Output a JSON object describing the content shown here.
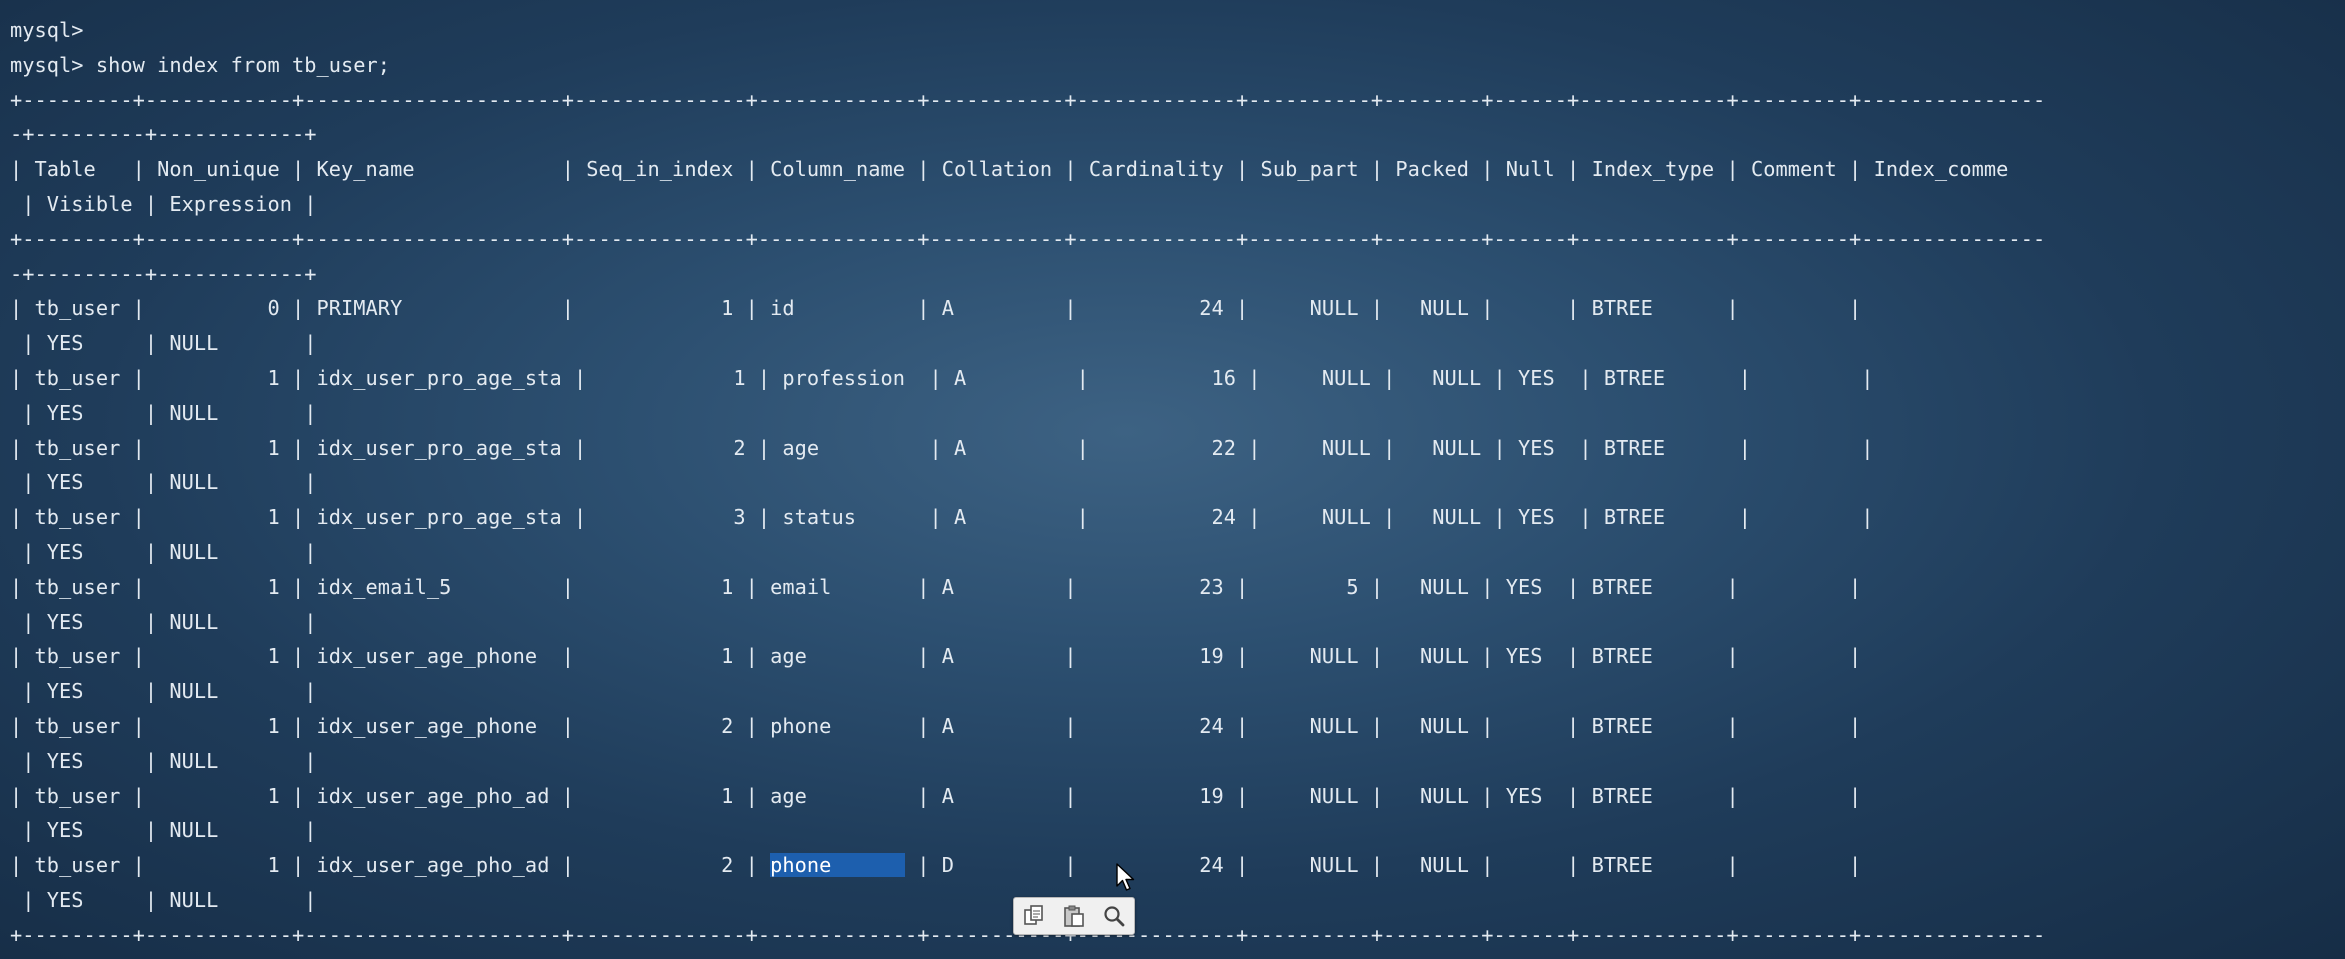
{
  "terminal": {
    "prompt_line": "mysql>",
    "command_line": "mysql> show index from tb_user;",
    "border_top_a": "+---------+------------+---------------------+--------------+-------------+-----------+-------------+----------+--------+------+------------+---------+---------------",
    "border_top_b": "-+---------+------------+",
    "header_a": "| Table   | Non_unique | Key_name            | Seq_in_index | Column_name | Collation | Cardinality | Sub_part | Packed | Null | Index_type | Comment | Index_comme",
    "header_b": " | Visible | Expression |",
    "border_mid_a": "+---------+------------+---------------------+--------------+-------------+-----------+-------------+----------+--------+------+------------+---------+---------------",
    "border_mid_b": "-+---------+------------+",
    "columns": [
      "Table",
      "Non_unique",
      "Key_name",
      "Seq_in_index",
      "Column_name",
      "Collation",
      "Cardinality",
      "Sub_part",
      "Packed",
      "Null",
      "Index_type",
      "Comment",
      "Index_comment",
      "Visible",
      "Expression"
    ],
    "rows": [
      {
        "a": "| tb_user |          0 | PRIMARY             |            1 | id          | A         |          24 |     NULL |   NULL |      | BTREE      |         |",
        "b": " | YES     | NULL       |"
      },
      {
        "a": "| tb_user |          1 | idx_user_pro_age_sta |            1 | profession  | A         |          16 |     NULL |   NULL | YES  | BTREE      |         |",
        "b": " | YES     | NULL       |"
      },
      {
        "a": "| tb_user |          1 | idx_user_pro_age_sta |            2 | age         | A         |          22 |     NULL |   NULL | YES  | BTREE      |         |",
        "b": " | YES     | NULL       |"
      },
      {
        "a": "| tb_user |          1 | idx_user_pro_age_sta |            3 | status      | A         |          24 |     NULL |   NULL | YES  | BTREE      |         |",
        "b": " | YES     | NULL       |"
      },
      {
        "a": "| tb_user |          1 | idx_email_5         |            1 | email       | A         |          23 |        5 |   NULL | YES  | BTREE      |         |",
        "b": " | YES     | NULL       |"
      },
      {
        "a": "| tb_user |          1 | idx_user_age_phone  |            1 | age         | A         |          19 |     NULL |   NULL | YES  | BTREE      |         |",
        "b": " | YES     | NULL       |"
      },
      {
        "a": "| tb_user |          1 | idx_user_age_phone  |            2 | phone       | A         |          24 |     NULL |   NULL |      | BTREE      |         |",
        "b": " | YES     | NULL       |"
      },
      {
        "a": "| tb_user |          1 | idx_user_age_pho_ad |            1 | age         | A         |          19 |     NULL |   NULL | YES  | BTREE      |         |",
        "b": " | YES     | NULL       |"
      }
    ],
    "last_row": {
      "pre": "| tb_user |          1 | idx_user_age_pho_ad |            2 | ",
      "selected": "phone      ",
      "post": " | D         |          24 |     NULL |   NULL |      | BTREE      |         |",
      "b": " | YES     | NULL       |"
    },
    "border_bottom_a": "+---------+------------+---------------------+--------------+-------------+-----------+-------------+----------+--------+------+------------+---------+---------------"
  },
  "toolbar": {
    "icons": [
      "copy-icon",
      "paste-icon",
      "search-icon"
    ]
  }
}
